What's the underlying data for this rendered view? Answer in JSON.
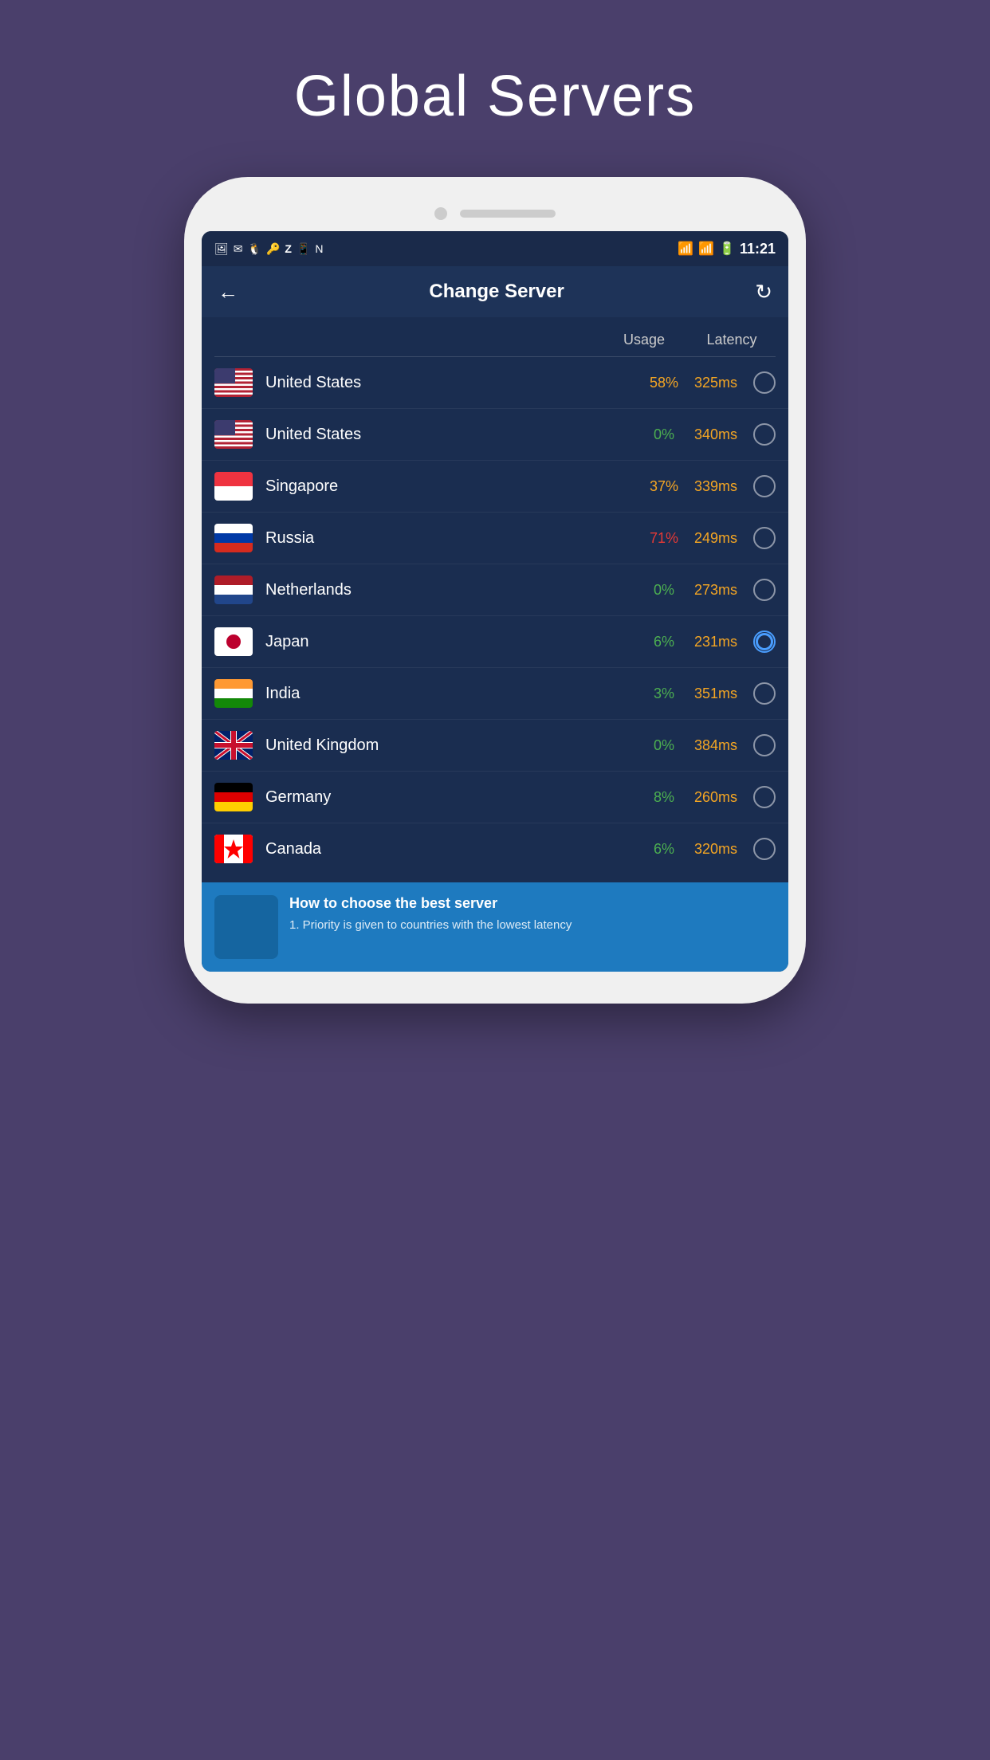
{
  "page": {
    "title": "Global Servers",
    "background_color": "#4a3f6b"
  },
  "header": {
    "title": "Change Server",
    "back_label": "←",
    "refresh_label": "↻"
  },
  "status_bar": {
    "time": "11:21",
    "icons": [
      "📷",
      "✉",
      "👤",
      "🔑",
      "Z",
      "📱",
      "N"
    ]
  },
  "server_list": {
    "column_usage": "Usage",
    "column_latency": "Latency",
    "servers": [
      {
        "id": 1,
        "country": "United States",
        "flag": "us",
        "usage": "58%",
        "usage_class": "usage-yellow",
        "latency": "325ms",
        "selected": false
      },
      {
        "id": 2,
        "country": "United States",
        "flag": "us",
        "usage": "0%",
        "usage_class": "usage-green",
        "latency": "340ms",
        "selected": false
      },
      {
        "id": 3,
        "country": "Singapore",
        "flag": "sg",
        "usage": "37%",
        "usage_class": "usage-yellow",
        "latency": "339ms",
        "selected": false
      },
      {
        "id": 4,
        "country": "Russia",
        "flag": "ru",
        "usage": "71%",
        "usage_class": "usage-red",
        "latency": "249ms",
        "selected": false
      },
      {
        "id": 5,
        "country": "Netherlands",
        "flag": "nl",
        "usage": "0%",
        "usage_class": "usage-green",
        "latency": "273ms",
        "selected": false
      },
      {
        "id": 6,
        "country": "Japan",
        "flag": "jp",
        "usage": "6%",
        "usage_class": "usage-green",
        "latency": "231ms",
        "selected": true
      },
      {
        "id": 7,
        "country": "India",
        "flag": "in",
        "usage": "3%",
        "usage_class": "usage-green",
        "latency": "351ms",
        "selected": false
      },
      {
        "id": 8,
        "country": "United Kingdom",
        "flag": "gb",
        "usage": "0%",
        "usage_class": "usage-green",
        "latency": "384ms",
        "selected": false
      },
      {
        "id": 9,
        "country": "Germany",
        "flag": "de",
        "usage": "8%",
        "usage_class": "usage-green",
        "latency": "260ms",
        "selected": false
      },
      {
        "id": 10,
        "country": "Canada",
        "flag": "ca",
        "usage": "6%",
        "usage_class": "usage-green",
        "latency": "320ms",
        "selected": false
      }
    ]
  },
  "info_section": {
    "title": "How to choose the best server",
    "description": "1. Priority is given to countries with the lowest latency"
  }
}
